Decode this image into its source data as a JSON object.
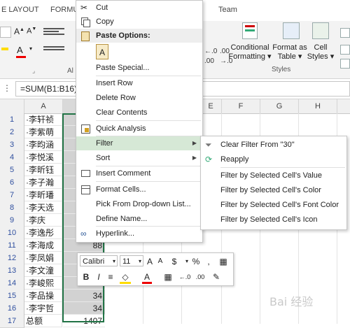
{
  "ribbon": {
    "tabs": [
      "E LAYOUT",
      "FORMU",
      "Team"
    ],
    "styles": {
      "conditional_formatting": [
        "Conditional",
        "Formatting ▾"
      ],
      "format_as_table": [
        "Format as",
        "Table ▾"
      ],
      "cell_styles": [
        "Cell",
        "Styles ▾"
      ],
      "group_label": "Styles"
    },
    "alignment_group_label": "Al"
  },
  "formula_bar": {
    "formula": "=SUM(B1:B16)"
  },
  "grid": {
    "columns": [
      "A",
      "E",
      "F",
      "G",
      "H"
    ],
    "rows": [
      {
        "num": "1",
        "a": "·李轩祯"
      },
      {
        "num": "2",
        "a": "·李紫萌"
      },
      {
        "num": "3",
        "a": "·李昀涵"
      },
      {
        "num": "4",
        "a": "·李悦溪"
      },
      {
        "num": "5",
        "a": "·李昕钰"
      },
      {
        "num": "6",
        "a": "·李子瀚"
      },
      {
        "num": "7",
        "a": "·李昕璠"
      },
      {
        "num": "8",
        "a": "·李天选"
      },
      {
        "num": "9",
        "a": "·李庆"
      },
      {
        "num": "10",
        "a": "·李逸彤"
      },
      {
        "num": "11",
        "a": "·李海成"
      },
      {
        "num": "12",
        "a": "·李凤娟"
      },
      {
        "num": "13",
        "a": "·李文潼"
      },
      {
        "num": "14",
        "a": "·李峻熙"
      },
      {
        "num": "15",
        "a": "·李品操"
      },
      {
        "num": "16",
        "a": "·李宇哲"
      },
      {
        "num": "17",
        "a": "总额"
      }
    ],
    "b_values": {
      "r11": "88",
      "r15": "34",
      "r16": "34",
      "r17": "1407"
    }
  },
  "context_menu": {
    "items": [
      {
        "label": "Cut"
      },
      {
        "label": "Copy"
      },
      {
        "label": "Paste Options:"
      },
      {
        "label": "Paste Special..."
      },
      {
        "label": "Insert Row"
      },
      {
        "label": "Delete Row"
      },
      {
        "label": "Clear Contents"
      },
      {
        "label": "Quick Analysis"
      },
      {
        "label": "Filter"
      },
      {
        "label": "Sort"
      },
      {
        "label": "Insert Comment"
      },
      {
        "label": "Format Cells..."
      },
      {
        "label": "Pick From Drop-down List..."
      },
      {
        "label": "Define Name..."
      },
      {
        "label": "Hyperlink..."
      }
    ]
  },
  "filter_submenu": {
    "items": [
      {
        "label": "Clear Filter From \"30\""
      },
      {
        "label": "Reapply"
      },
      {
        "label": "Filter by Selected Cell's Value"
      },
      {
        "label": "Filter by Selected Cell's Color"
      },
      {
        "label": "Filter by Selected Cell's Font Color"
      },
      {
        "label": "Filter by Selected Cell's Icon"
      }
    ]
  },
  "mini_toolbar": {
    "font": "Calibri",
    "size": "11",
    "bold": "B",
    "italic": "I",
    "dollar": "$",
    "percent": "%",
    "comma": ","
  },
  "watermark": "Bai 经验",
  "colors": {
    "menu_highlight": "#d6e8d6",
    "selection_border": "#217346"
  }
}
